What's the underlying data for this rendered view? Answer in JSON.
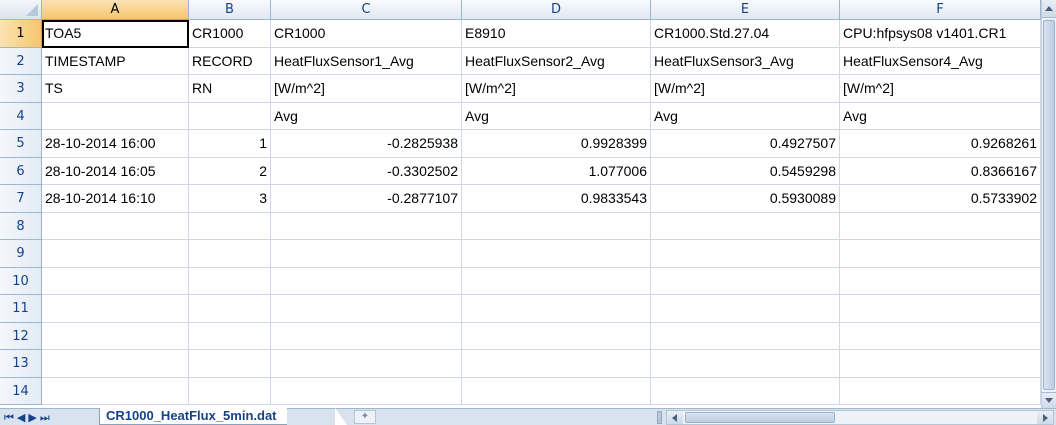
{
  "columns": [
    "A",
    "B",
    "C",
    "D",
    "E",
    "F"
  ],
  "rows": [
    {
      "num": "1",
      "cells": [
        "TOA5",
        "CR1000",
        "CR1000",
        "E8910",
        "CR1000.Std.27.04",
        "CPU:hfpsys08 v1401.CR1"
      ]
    },
    {
      "num": "2",
      "cells": [
        "TIMESTAMP",
        "RECORD",
        "HeatFluxSensor1_Avg",
        "HeatFluxSensor2_Avg",
        "HeatFluxSensor3_Avg",
        "HeatFluxSensor4_Avg"
      ]
    },
    {
      "num": "3",
      "cells": [
        "TS",
        "RN",
        "[W/m^2]",
        "[W/m^2]",
        "[W/m^2]",
        "[W/m^2]"
      ]
    },
    {
      "num": "4",
      "cells": [
        "",
        "",
        "Avg",
        "Avg",
        "Avg",
        "Avg"
      ]
    },
    {
      "num": "5",
      "cells": [
        "28-10-2014 16:00",
        "1",
        "-0.2825938",
        "0.9928399",
        "0.4927507",
        "0.9268261"
      ]
    },
    {
      "num": "6",
      "cells": [
        "28-10-2014 16:05",
        "2",
        "-0.3302502",
        "1.077006",
        "0.5459298",
        "0.8366167"
      ]
    },
    {
      "num": "7",
      "cells": [
        "28-10-2014 16:10",
        "3",
        "-0.2877107",
        "0.9833543",
        "0.5930089",
        "0.5733902"
      ]
    },
    {
      "num": "8",
      "cells": [
        "",
        "",
        "",
        "",
        "",
        ""
      ]
    },
    {
      "num": "9",
      "cells": [
        "",
        "",
        "",
        "",
        "",
        ""
      ]
    },
    {
      "num": "10",
      "cells": [
        "",
        "",
        "",
        "",
        "",
        ""
      ]
    },
    {
      "num": "11",
      "cells": [
        "",
        "",
        "",
        "",
        "",
        ""
      ]
    },
    {
      "num": "12",
      "cells": [
        "",
        "",
        "",
        "",
        "",
        ""
      ]
    },
    {
      "num": "13",
      "cells": [
        "",
        "",
        "",
        "",
        "",
        ""
      ]
    },
    {
      "num": "14",
      "cells": [
        "",
        "",
        "",
        "",
        "",
        ""
      ]
    }
  ],
  "selection": {
    "column": "A",
    "row": "1"
  },
  "sheet_tab": {
    "name": "CR1000_HeatFlux_5min.dat"
  },
  "icons": {
    "nav": [
      "first-sheet-icon",
      "prev-sheet-icon",
      "next-sheet-icon",
      "last-sheet-icon"
    ],
    "insert_sheet": "insert-sheet-icon"
  },
  "colors": {
    "header_bg": "#dfe8f2",
    "selected_header": "#f6c66d",
    "gridline": "#d0d7e5",
    "header_text": "#15428b"
  }
}
